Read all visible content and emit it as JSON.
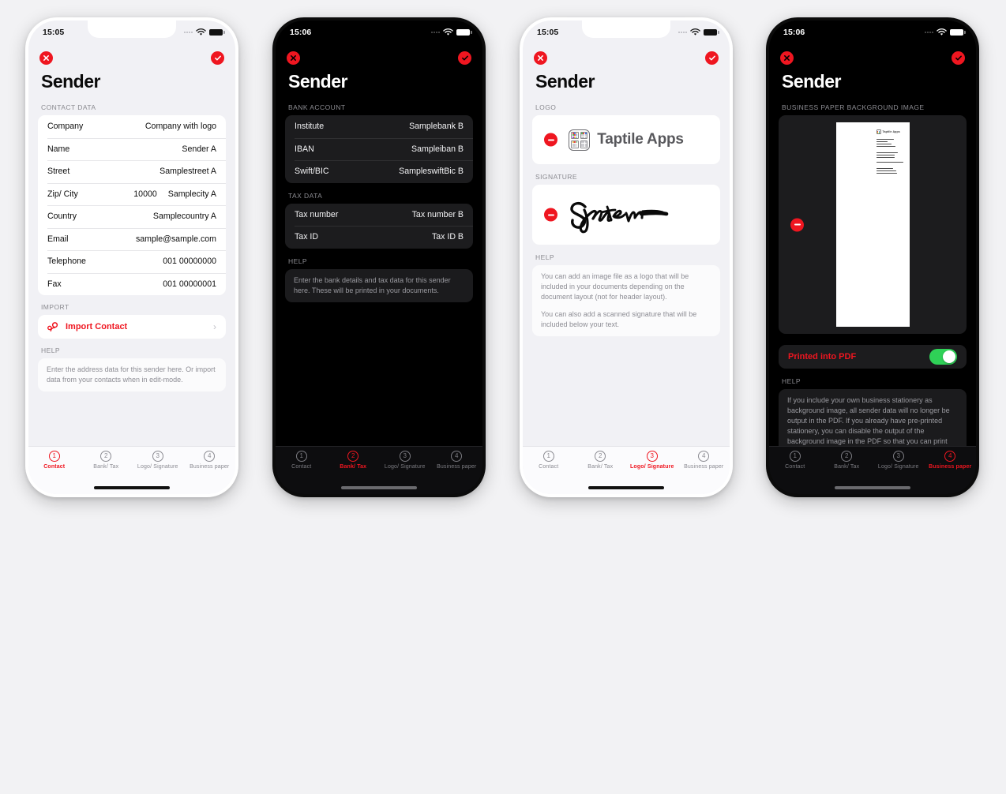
{
  "screens": [
    {
      "id": "contact",
      "theme": "light",
      "status": {
        "time": "15:05",
        "wifi": "wifi-icon",
        "battery": "battery-icon"
      },
      "nav": {
        "close": "close-icon",
        "confirm": "confirm-icon"
      },
      "title": "Sender",
      "sections": {
        "contact_label": "CONTACT DATA",
        "contact_rows": [
          {
            "key": "Company",
            "mid": "",
            "value": "Company with logo"
          },
          {
            "key": "Name",
            "mid": "",
            "value": "Sender A"
          },
          {
            "key": "Street",
            "mid": "",
            "value": "Samplestreet A"
          },
          {
            "key": "Zip/ City",
            "mid": "10000",
            "value": "Samplecity A"
          },
          {
            "key": "Country",
            "mid": "",
            "value": "Samplecountry A"
          },
          {
            "key": "Email",
            "mid": "",
            "value": "sample@sample.com"
          },
          {
            "key": "Telephone",
            "mid": "",
            "value": "001 00000000"
          },
          {
            "key": "Fax",
            "mid": "",
            "value": "001 00000001"
          }
        ],
        "import_label": "IMPORT",
        "import_action": "Import Contact",
        "import_chevron": "chevron-right-icon",
        "help_label": "HELP",
        "help_paragraphs": [
          "Enter the address data for this sender here. Or import data from your contacts when in edit-mode."
        ]
      },
      "tabs": [
        {
          "num": "1",
          "label": "Contact",
          "active": true
        },
        {
          "num": "2",
          "label": "Bank/ Tax",
          "active": false
        },
        {
          "num": "3",
          "label": "Logo/ Signature",
          "active": false
        },
        {
          "num": "4",
          "label": "Business paper",
          "active": false
        }
      ]
    },
    {
      "id": "bank-tax",
      "theme": "dark",
      "status": {
        "time": "15:06",
        "wifi": "wifi-icon",
        "battery": "battery-icon"
      },
      "nav": {
        "close": "close-icon",
        "confirm": "confirm-icon"
      },
      "title": "Sender",
      "sections": {
        "bank_label": "BANK ACCOUNT",
        "bank_rows": [
          {
            "key": "Institute",
            "mid": "",
            "value": "Samplebank B"
          },
          {
            "key": "IBAN",
            "mid": "",
            "value": "Sampleiban B"
          },
          {
            "key": "Swift/BIC",
            "mid": "",
            "value": "SampleswiftBic B"
          }
        ],
        "tax_label": "TAX DATA",
        "tax_rows": [
          {
            "key": "Tax number",
            "mid": "",
            "value": "Tax number B"
          },
          {
            "key": "Tax ID",
            "mid": "",
            "value": "Tax ID B"
          }
        ],
        "help_label": "HELP",
        "help_paragraphs": [
          "Enter the bank details and tax data for this sender here. These will be printed in your documents."
        ]
      },
      "tabs": [
        {
          "num": "1",
          "label": "Contact",
          "active": false
        },
        {
          "num": "2",
          "label": "Bank/ Tax",
          "active": true
        },
        {
          "num": "3",
          "label": "Logo/ Signature",
          "active": false
        },
        {
          "num": "4",
          "label": "Business paper",
          "active": false
        }
      ]
    },
    {
      "id": "logo-signature",
      "theme": "light",
      "status": {
        "time": "15:05",
        "wifi": "wifi-icon",
        "battery": "battery-icon"
      },
      "nav": {
        "close": "close-icon",
        "confirm": "confirm-icon"
      },
      "title": "Sender",
      "sections": {
        "logo_label": "LOGO",
        "logo_remove": "minus-remove-icon",
        "logo_name": "Taptile Apps",
        "logo_mark": "taptile-tile-icon",
        "signature_label": "SIGNATURE",
        "signature_remove": "minus-remove-icon",
        "signature_image": "handwritten-signature",
        "help_label": "HELP",
        "help_paragraphs": [
          "You can add an image file as a logo that will be included in your documents depending on the document layout (not for header layout).",
          "You can also add a scanned signature that will be included below your text."
        ]
      },
      "tabs": [
        {
          "num": "1",
          "label": "Contact",
          "active": false
        },
        {
          "num": "2",
          "label": "Bank/ Tax",
          "active": false
        },
        {
          "num": "3",
          "label": "Logo/ Signature",
          "active": true
        },
        {
          "num": "4",
          "label": "Business paper",
          "active": false
        }
      ]
    },
    {
      "id": "business-paper",
      "theme": "dark",
      "status": {
        "time": "15:06",
        "wifi": "wifi-icon",
        "battery": "battery-icon"
      },
      "nav": {
        "close": "close-icon",
        "confirm": "confirm-icon"
      },
      "title": "Sender",
      "sections": {
        "paper_label": "BUSINESS PAPER BACKGROUND IMAGE",
        "paper_remove": "minus-remove-icon",
        "paper_brand": "Taptile Apps",
        "toggle_label": "Printed into PDF",
        "toggle_state": "on",
        "help_label": "HELP",
        "help_paragraphs": [
          "If you include your own business stationery as background image, all sender data will no longer be output in the PDF. If you already have pre-printed stationery, you can disable the output of the background image in the PDF so that you can print the PDF directly"
        ]
      },
      "tabs": [
        {
          "num": "1",
          "label": "Contact",
          "active": false
        },
        {
          "num": "2",
          "label": "Bank/ Tax",
          "active": false
        },
        {
          "num": "3",
          "label": "Logo/ Signature",
          "active": false
        },
        {
          "num": "4",
          "label": "Business paper",
          "active": true
        }
      ]
    }
  ],
  "colors": {
    "accent_red": "#ef1620",
    "toggle_green": "#2fd157",
    "light_bg": "#f1f1f5",
    "dark_bg": "#000000",
    "card_light": "#ffffff",
    "card_dark": "#1c1c1e"
  }
}
